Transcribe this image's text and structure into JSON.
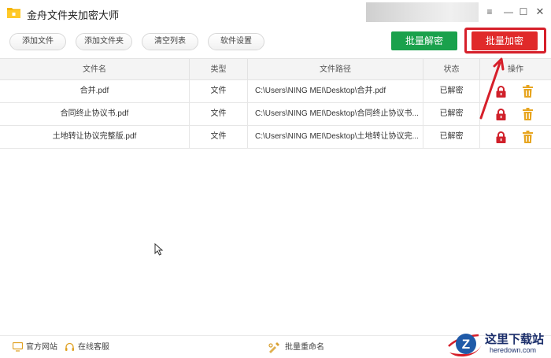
{
  "app": {
    "title": "金舟文件夹加密大师"
  },
  "window_controls": {
    "menu": "≡",
    "minimize": "—",
    "maximize": "☐",
    "close": "✕"
  },
  "toolbar": {
    "add_file": "添加文件",
    "add_folder": "添加文件夹",
    "clear_list": "清空列表",
    "settings": "软件设置",
    "batch_decrypt": "批量解密",
    "batch_encrypt": "批量加密"
  },
  "table": {
    "headers": [
      "文件名",
      "类型",
      "文件路径",
      "状态",
      "操作"
    ],
    "rows": [
      {
        "name": "合并.pdf",
        "type": "文件",
        "path": "C:\\Users\\NING MEI\\Desktop\\合并.pdf",
        "status": "已解密"
      },
      {
        "name": "合同终止协议书.pdf",
        "type": "文件",
        "path": "C:\\Users\\NING MEI\\Desktop\\合同终止协议书...",
        "status": "已解密"
      },
      {
        "name": "土地转让协议完整版.pdf",
        "type": "文件",
        "path": "C:\\Users\\NING MEI\\Desktop\\土地转让协议完...",
        "status": "已解密"
      }
    ]
  },
  "statusbar": {
    "website": "官方网站",
    "support": "在线客服",
    "rename": "批量重命名"
  },
  "watermark": {
    "cn": "这里下载站",
    "en": "heredown.com"
  },
  "colors": {
    "decrypt": "#1aa14c",
    "encrypt": "#e02a2a",
    "highlight": "#d61f2a",
    "lock": "#d0202a",
    "trash": "#e7a520"
  }
}
